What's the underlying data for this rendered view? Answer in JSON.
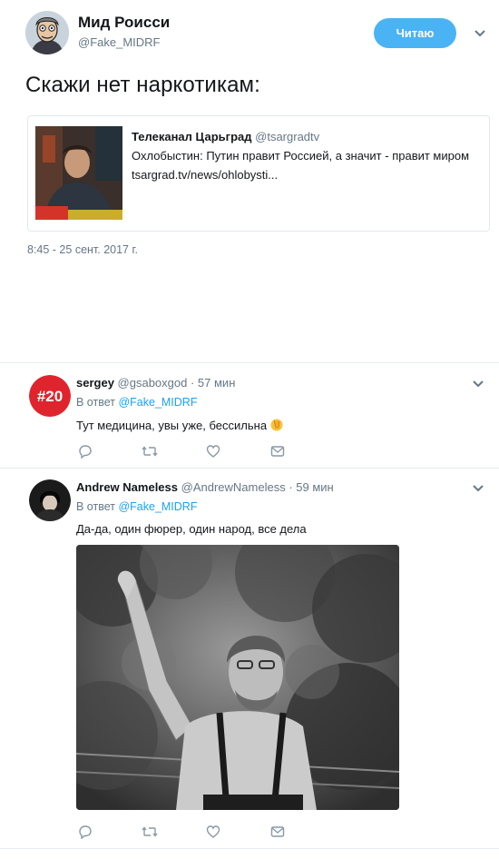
{
  "main_tweet": {
    "author_name": "Мид Роисси",
    "author_handle": "@Fake_MIDRF",
    "follow_label": "Читаю",
    "text": "Скажи нет наркотикам:",
    "timestamp": "8:45 - 25 сент. 2017 г.",
    "quoted": {
      "author_name": "Телеканал Царьград",
      "author_handle": "@tsargradtv",
      "text": "Охлобыстин: Путин правит Россией, а значит - правит миром",
      "link": "tsargrad.tv/news/ohlobysti..."
    }
  },
  "replies": [
    {
      "name": "sergey",
      "handle": "@gsaboxgod",
      "time": "· 57 мин",
      "in_reply_prefix": "В ответ",
      "in_reply_to": "@Fake_MIDRF",
      "text": "Тут медицина, увы уже, бессильна",
      "avatar_text": "#20"
    },
    {
      "name": "Andrew Nameless",
      "handle": "@AndrewNameless",
      "time": "· 59 мин",
      "in_reply_prefix": "В ответ",
      "in_reply_to": "@Fake_MIDRF",
      "text": "Да-да, один фюрер, один народ, все дела"
    }
  ],
  "colors": {
    "accent": "#1da1f2",
    "follow_button": "#4ab3f4",
    "muted": "#657786",
    "border": "#e1e8ed"
  },
  "icons": [
    "chevron-down-icon",
    "reply-icon",
    "retweet-icon",
    "like-icon",
    "message-icon",
    "facepalm-emoji"
  ]
}
